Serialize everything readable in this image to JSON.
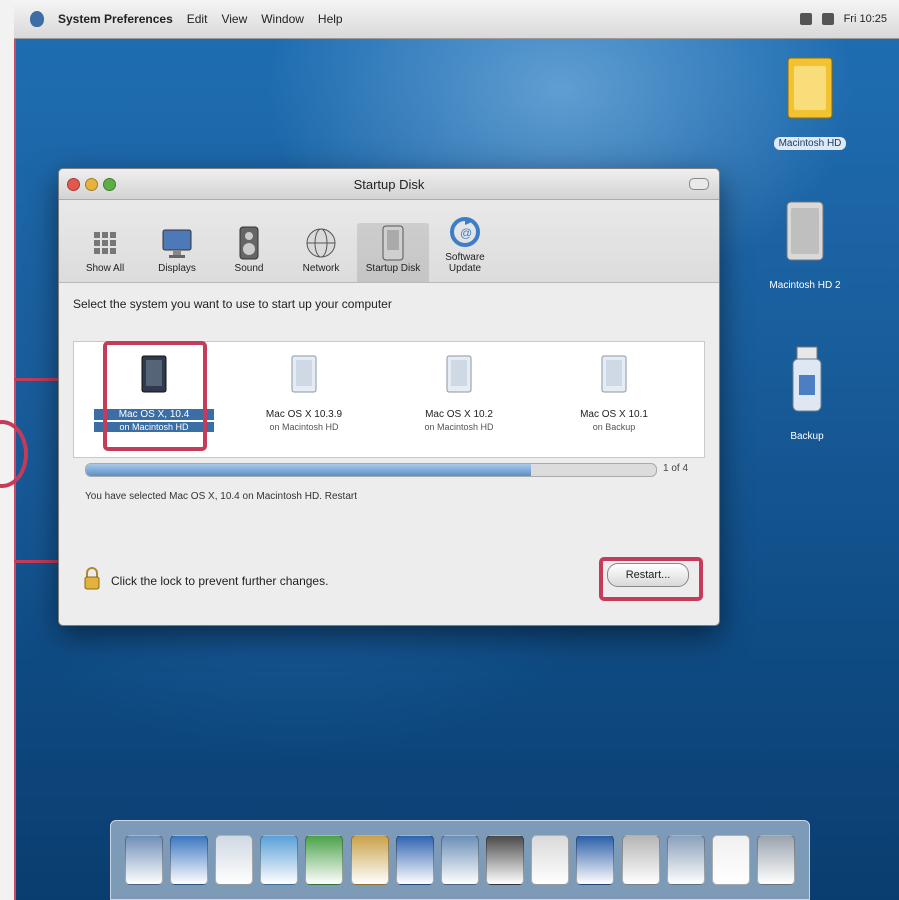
{
  "menubar": {
    "app_name": "System Preferences",
    "items": [
      "Edit",
      "View",
      "Window",
      "Help"
    ],
    "clock": "Fri 10:25"
  },
  "window": {
    "title": "Startup Disk",
    "toolbar": [
      {
        "label": "Show All",
        "icon": "grid-icon"
      },
      {
        "label": "Displays",
        "icon": "display-icon"
      },
      {
        "label": "Sound",
        "icon": "speaker-icon"
      },
      {
        "label": "Network",
        "icon": "globe-icon"
      },
      {
        "label": "Startup Disk",
        "icon": "disk-icon"
      },
      {
        "label": "Software Update",
        "icon": "update-icon"
      }
    ],
    "prompt": "Select the system you want to use to start up your computer",
    "disks": [
      {
        "name": "Mac OS X, 10.4",
        "sub": "on Macintosh HD",
        "selected": true
      },
      {
        "name": "Mac OS X 10.3.9",
        "sub": "on Macintosh HD"
      },
      {
        "name": "Mac OS X 10.2",
        "sub": "on Macintosh HD"
      },
      {
        "name": "Mac OS X 10.1",
        "sub": "on Backup"
      }
    ],
    "progress": {
      "fraction": 0.78,
      "label": "1 of 4"
    },
    "status": "You have selected Mac OS X, 10.4 on Macintosh HD. Restart",
    "lock_text": "Click the lock to prevent further changes.",
    "restart_label": "Restart..."
  },
  "desktop_icons": [
    {
      "label": "Macintosh HD",
      "icon": "hard-drive-icon",
      "selected": true
    },
    {
      "label": "Macintosh HD 2",
      "icon": "disk-icon"
    },
    {
      "label": "Backup",
      "icon": "usb-drive-icon"
    }
  ],
  "dock": {
    "items": [
      "finder-icon",
      "dashboard-icon",
      "mail-icon",
      "safari-icon",
      "ichat-icon",
      "address-book-icon",
      "itunes-icon",
      "iphoto-icon",
      "imovie-icon",
      "ical-icon",
      "quicktime-icon",
      "system-preferences-icon",
      "preview-icon",
      "textedit-icon",
      "trash-icon"
    ]
  },
  "colors": {
    "highlight": "#c53c5a",
    "desktop_blue": "#1a5f9e",
    "selection_blue": "#3a6ea5"
  }
}
